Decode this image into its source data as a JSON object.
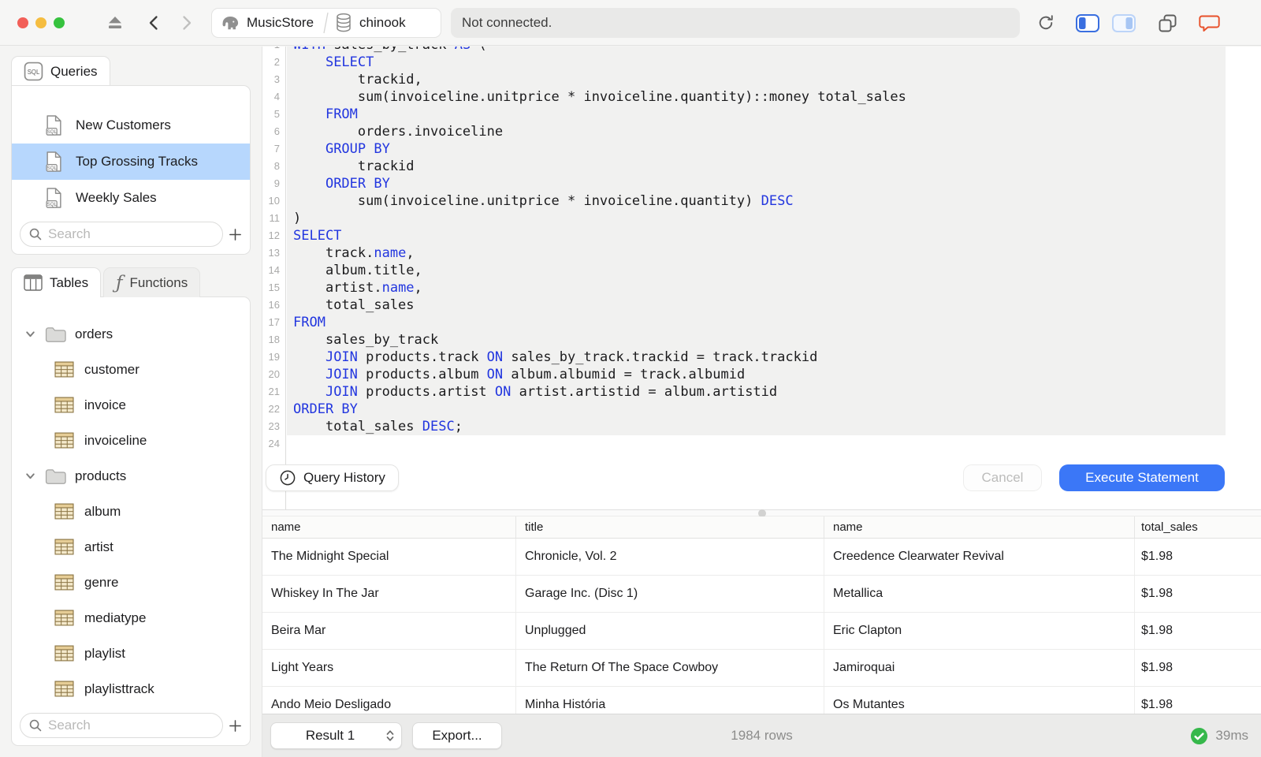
{
  "window": {
    "status_text": "Not connected.",
    "breadcrumb": {
      "connection": "MusicStore",
      "database": "chinook"
    }
  },
  "sidebar": {
    "queries": {
      "tab": "Queries",
      "items": [
        {
          "label": "New Customers",
          "selected": false
        },
        {
          "label": "Top Grossing Tracks",
          "selected": true
        },
        {
          "label": "Weekly Sales",
          "selected": false
        }
      ],
      "search_placeholder": "Search"
    },
    "schema": {
      "tables_tab": "Tables",
      "functions_tab": "Functions",
      "functions_glyph": "ƒ",
      "tree": [
        {
          "kind": "folder",
          "label": "orders",
          "expanded": true
        },
        {
          "kind": "table",
          "label": "customer"
        },
        {
          "kind": "table",
          "label": "invoice"
        },
        {
          "kind": "table",
          "label": "invoiceline"
        },
        {
          "kind": "folder",
          "label": "products",
          "expanded": true
        },
        {
          "kind": "table",
          "label": "album"
        },
        {
          "kind": "table",
          "label": "artist"
        },
        {
          "kind": "table",
          "label": "genre"
        },
        {
          "kind": "table",
          "label": "mediatype"
        },
        {
          "kind": "table",
          "label": "playlist"
        },
        {
          "kind": "table",
          "label": "playlisttrack"
        }
      ],
      "search_placeholder": "Search"
    }
  },
  "editor": {
    "history_button": "Query History",
    "cancel_button": "Cancel",
    "execute_button": "Execute Statement",
    "lines": [
      {
        "hl": true,
        "seg": [
          [
            "WITH",
            1
          ],
          [
            " sales_by_track ",
            0
          ],
          [
            "AS",
            1
          ],
          [
            " (",
            0
          ]
        ]
      },
      {
        "hl": true,
        "seg": [
          [
            "    ",
            0
          ],
          [
            "SELECT",
            1
          ]
        ]
      },
      {
        "hl": true,
        "seg": [
          [
            "        trackid,",
            0
          ]
        ]
      },
      {
        "hl": true,
        "seg": [
          [
            "        sum(invoiceline.unitprice * invoiceline.quantity)::money total_sales",
            0
          ]
        ]
      },
      {
        "hl": true,
        "seg": [
          [
            "    ",
            0
          ],
          [
            "FROM",
            1
          ]
        ]
      },
      {
        "hl": true,
        "seg": [
          [
            "        orders.invoiceline",
            0
          ]
        ]
      },
      {
        "hl": true,
        "seg": [
          [
            "    ",
            0
          ],
          [
            "GROUP BY",
            1
          ]
        ]
      },
      {
        "hl": true,
        "seg": [
          [
            "        trackid",
            0
          ]
        ]
      },
      {
        "hl": true,
        "seg": [
          [
            "    ",
            0
          ],
          [
            "ORDER BY",
            1
          ]
        ]
      },
      {
        "hl": true,
        "seg": [
          [
            "        sum(invoiceline.unitprice * invoiceline.quantity) ",
            0
          ],
          [
            "DESC",
            1
          ]
        ]
      },
      {
        "hl": true,
        "seg": [
          [
            ")",
            0
          ]
        ]
      },
      {
        "hl": true,
        "seg": [
          [
            "SELECT",
            1
          ]
        ]
      },
      {
        "hl": true,
        "seg": [
          [
            "    track.",
            0
          ],
          [
            "name",
            1
          ],
          [
            ",",
            0
          ]
        ]
      },
      {
        "hl": true,
        "seg": [
          [
            "    album.title,",
            0
          ]
        ]
      },
      {
        "hl": true,
        "seg": [
          [
            "    artist.",
            0
          ],
          [
            "name",
            1
          ],
          [
            ",",
            0
          ]
        ]
      },
      {
        "hl": true,
        "seg": [
          [
            "    total_sales",
            0
          ]
        ]
      },
      {
        "hl": true,
        "seg": [
          [
            "FROM",
            1
          ]
        ]
      },
      {
        "hl": true,
        "seg": [
          [
            "    sales_by_track",
            0
          ]
        ]
      },
      {
        "hl": true,
        "seg": [
          [
            "    ",
            0
          ],
          [
            "JOIN",
            1
          ],
          [
            " products.track ",
            0
          ],
          [
            "ON",
            1
          ],
          [
            " sales_by_track.trackid = track.trackid",
            0
          ]
        ]
      },
      {
        "hl": true,
        "seg": [
          [
            "    ",
            0
          ],
          [
            "JOIN",
            1
          ],
          [
            " products.album ",
            0
          ],
          [
            "ON",
            1
          ],
          [
            " album.albumid = track.albumid",
            0
          ]
        ]
      },
      {
        "hl": true,
        "seg": [
          [
            "    ",
            0
          ],
          [
            "JOIN",
            1
          ],
          [
            " products.artist ",
            0
          ],
          [
            "ON",
            1
          ],
          [
            " artist.artistid = album.artistid",
            0
          ]
        ]
      },
      {
        "hl": true,
        "seg": [
          [
            "ORDER BY",
            1
          ]
        ]
      },
      {
        "hl": true,
        "seg": [
          [
            "    total_sales ",
            0
          ],
          [
            "DESC",
            1
          ],
          [
            ";",
            0
          ]
        ]
      },
      {
        "hl": false,
        "seg": []
      }
    ]
  },
  "results": {
    "columns": [
      "name",
      "title",
      "name",
      "total_sales"
    ],
    "rows": [
      [
        "The Midnight Special",
        "Chronicle, Vol. 2",
        "Creedence Clearwater Revival",
        "$1.98"
      ],
      [
        "Whiskey In The Jar",
        "Garage Inc. (Disc 1)",
        "Metallica",
        "$1.98"
      ],
      [
        "Beira Mar",
        "Unplugged",
        "Eric Clapton",
        "$1.98"
      ],
      [
        "Light Years",
        "The Return Of The Space Cowboy",
        "Jamiroquai",
        "$1.98"
      ],
      [
        "Ando Meio Desligado",
        "Minha História",
        "Os Mutantes",
        "$1.98"
      ]
    ],
    "result_selector": "Result 1",
    "export_button": "Export...",
    "row_count": "1984 rows",
    "duration": "39ms"
  },
  "colors": {
    "accent_blue": "#3b77f7",
    "keyword_blue": "#2236df",
    "selection_blue": "#b7d7fd",
    "success_green": "#36b84b",
    "chat_orange": "#e8502a"
  }
}
